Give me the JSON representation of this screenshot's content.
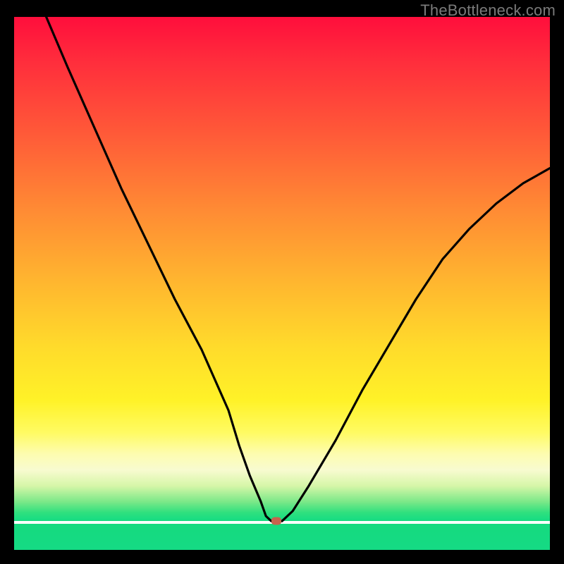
{
  "watermark": "TheBottleneck.com",
  "colors": {
    "frame": "#000000",
    "gradient_top": "#ff0e3c",
    "gradient_mid": "#ffdb2b",
    "gradient_bottom": "#15da84",
    "curve": "#000000",
    "marker": "#c7624d"
  },
  "chart_data": {
    "type": "line",
    "title": "",
    "xlabel": "",
    "ylabel": "",
    "xlim": [
      0,
      100
    ],
    "ylim": [
      0,
      100
    ],
    "grid": false,
    "legend": false,
    "series": [
      {
        "name": "bottleneck_curve",
        "x": [
          6,
          10,
          15,
          20,
          25,
          30,
          35,
          40,
          42,
          44,
          46,
          47,
          48,
          50,
          52,
          55,
          60,
          65,
          70,
          75,
          80,
          85,
          90,
          95,
          100
        ],
        "y": [
          100,
          90,
          78,
          66,
          55,
          44,
          34,
          22,
          15,
          9,
          4,
          1,
          0,
          0,
          2,
          7,
          16,
          26,
          35,
          44,
          52,
          58,
          63,
          67,
          70
        ]
      }
    ],
    "annotations": [
      {
        "name": "min_marker",
        "x": 49,
        "y": 0
      }
    ]
  }
}
